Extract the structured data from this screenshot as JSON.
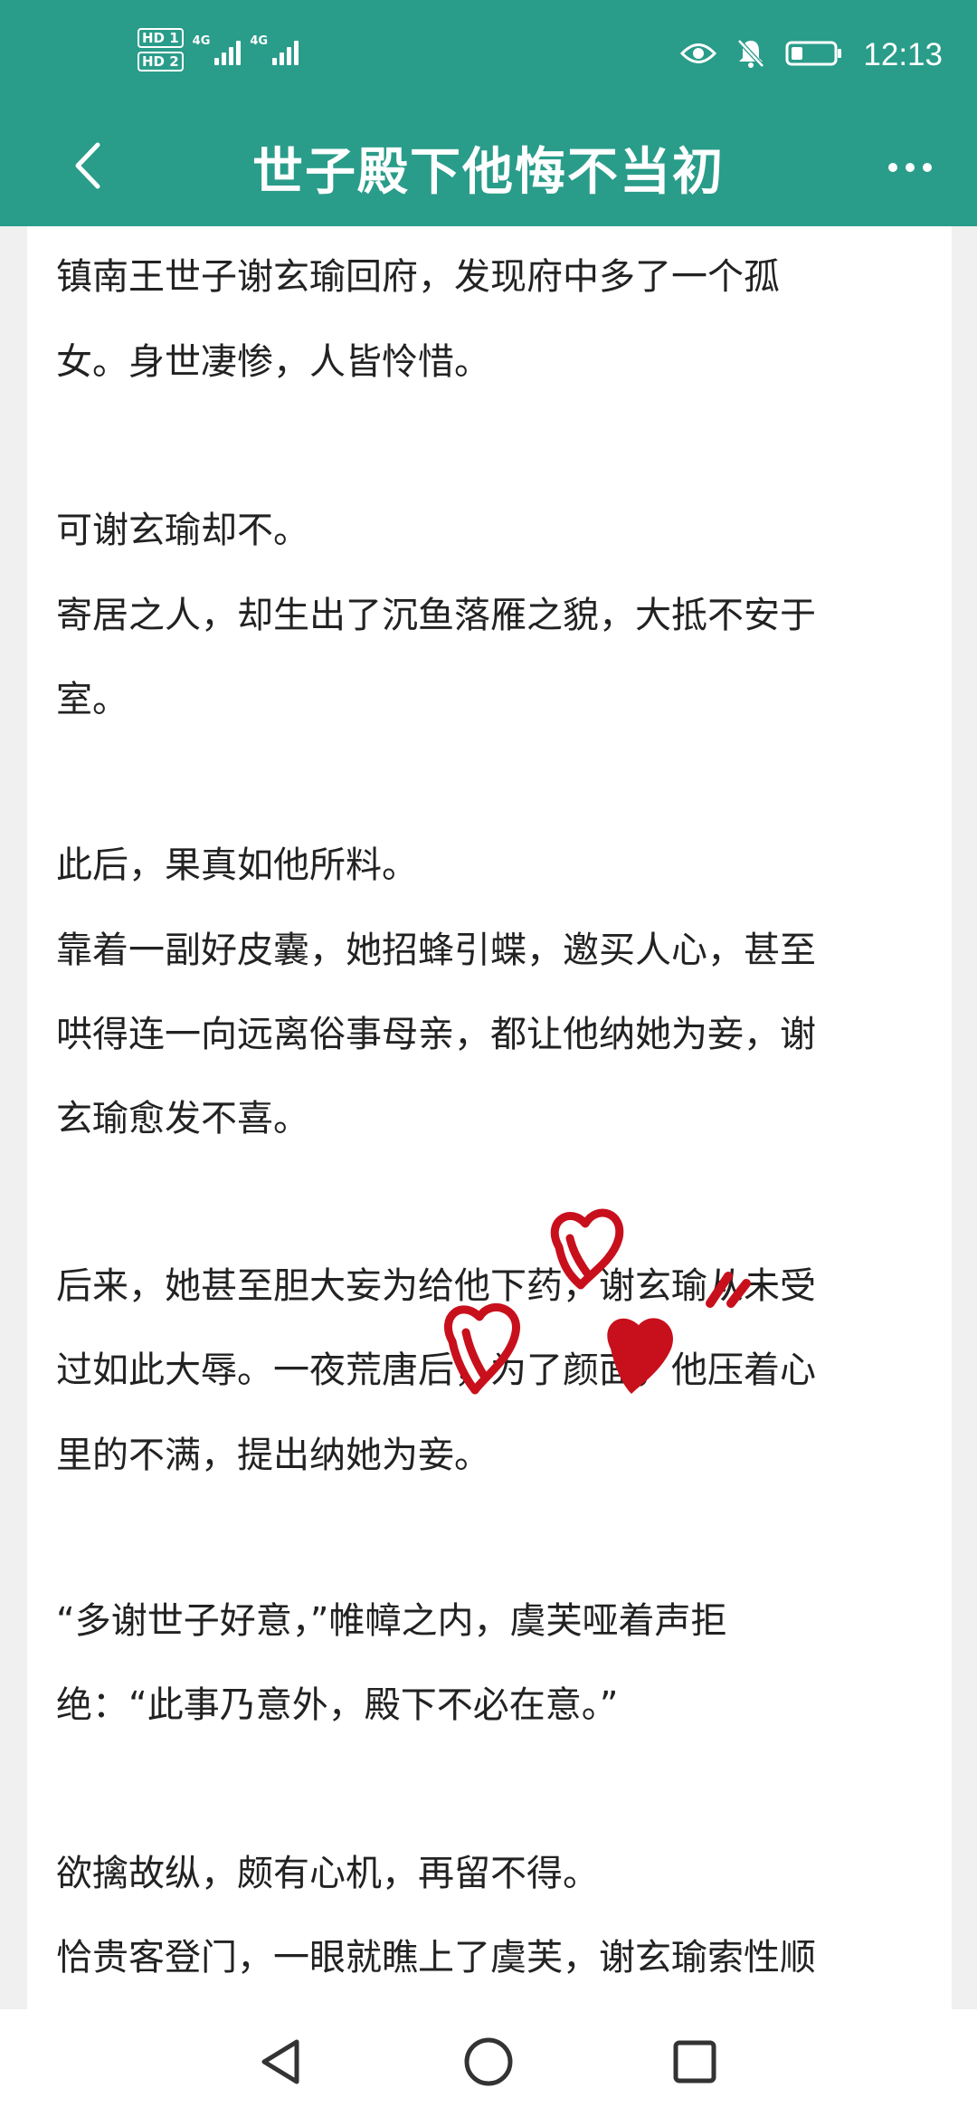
{
  "status_bar": {
    "sim1_badge": "HD 1",
    "sim2_badge": "HD 2",
    "network1": "4G",
    "network2": "4G",
    "time": "12:13",
    "icons": [
      "eye-icon",
      "bell-off-icon",
      "battery-icon"
    ]
  },
  "header": {
    "title": "世子殿下他悔不当初",
    "back_icon": "chevron-left-icon",
    "more_icon": "more-dots-icon",
    "background_color": "#2a9c8a"
  },
  "content": {
    "lines": [
      "镇南王世子谢玄瑜回府，发现府中多了一个孤",
      "女。身世凄惨，人皆怜惜。",
      "可谢玄瑜却不。",
      "寄居之人，却生出了沉鱼落雁之貌，大抵不安于",
      "室。",
      "此后，果真如他所料。",
      "靠着一副好皮囊，她招蜂引蝶，邀买人心，甚至",
      "哄得连一向远离俗事母亲，都让他纳她为妾，谢",
      "玄瑜愈发不喜。",
      "后来，她甚至胆大妄为给他下药，谢玄瑜从未受",
      "过如此大辱。一夜荒唐后，为了颜面，他压着心",
      "里的不满，提出纳她为妾。",
      "“多谢世子好意，”帷幛之内，虞芙哑着声拒",
      "绝：“此事乃意外，殿下不必在意。”",
      "欲擒故纵，颇有心机，再留不得。",
      "恰贵客登门，一眼就瞧上了虞芙，谢玄瑜索性顺"
    ],
    "annotation": "red heart doodles",
    "annotation_color": "#c8101c"
  },
  "bottom_nav": {
    "icons": [
      "back-triangle-icon",
      "home-circle-icon",
      "recents-square-icon"
    ]
  }
}
